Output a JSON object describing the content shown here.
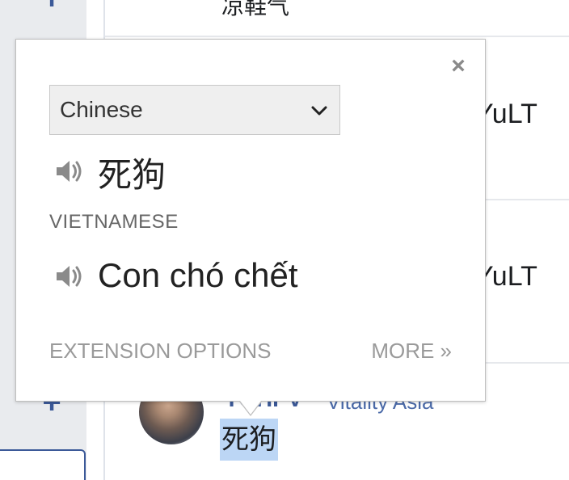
{
  "background": {
    "top_fragment": "凉鞋气",
    "right_fragment_1": "YuLT",
    "right_fragment_2": "YuLT",
    "author": "TGHPV",
    "author_suffix": "Vitality Asia",
    "selected_word": "死狗",
    "plus_icon": "plus-icon"
  },
  "popup": {
    "close_glyph": "×",
    "source_language": "Chinese",
    "source_text": "死狗",
    "target_language_label": "VIETNAMESE",
    "target_text": "Con chó chết",
    "extension_options_label": "EXTENSION OPTIONS",
    "more_label": "MORE »",
    "speaker_icon": "speaker-icon"
  },
  "colors": {
    "selection": "#bcd6f5",
    "link_blue": "#3b5998",
    "muted_text": "#9a9a9a"
  }
}
